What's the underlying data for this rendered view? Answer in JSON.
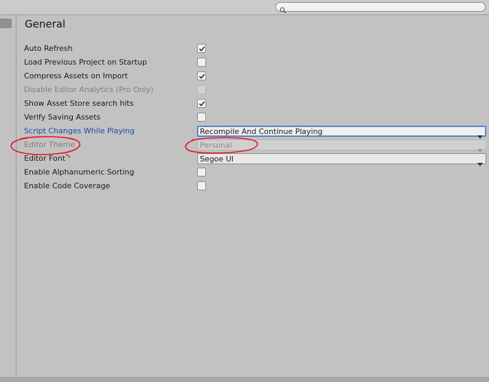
{
  "search": {
    "placeholder": ""
  },
  "panel": {
    "title": "General"
  },
  "settings": [
    {
      "label": "Auto Refresh",
      "type": "checkbox",
      "checked": true,
      "disabled": false
    },
    {
      "label": "Load Previous Project on Startup",
      "type": "checkbox",
      "checked": false,
      "disabled": false
    },
    {
      "label": "Compress Assets on Import",
      "type": "checkbox",
      "checked": true,
      "disabled": false
    },
    {
      "label": "Disable Editor Analytics (Pro Only)",
      "type": "checkbox",
      "checked": false,
      "disabled": true
    },
    {
      "label": "Show Asset Store search hits",
      "type": "checkbox",
      "checked": true,
      "disabled": false
    },
    {
      "label": "Verify Saving Assets",
      "type": "checkbox",
      "checked": false,
      "disabled": false
    },
    {
      "label": "Script Changes While Playing",
      "type": "dropdown",
      "value": "Recompile And Continue Playing",
      "disabled": false
    },
    {
      "label": "Editor Theme",
      "type": "dropdown",
      "value": "Personal",
      "disabled": true
    },
    {
      "label": "Editor Font",
      "type": "dropdown",
      "value": "Segoe UI",
      "disabled": false
    },
    {
      "label": "Enable Alphanumeric Sorting",
      "type": "checkbox",
      "checked": false,
      "disabled": false
    },
    {
      "label": "Enable Code Coverage",
      "type": "checkbox",
      "checked": false,
      "disabled": false
    }
  ],
  "colors": {
    "annotation": "#e0141b",
    "active_label": "#1d4a9a"
  },
  "icons": {
    "search": "search-icon",
    "check": "checkmark-icon",
    "dropdown": "dropdown-arrow-icon"
  }
}
